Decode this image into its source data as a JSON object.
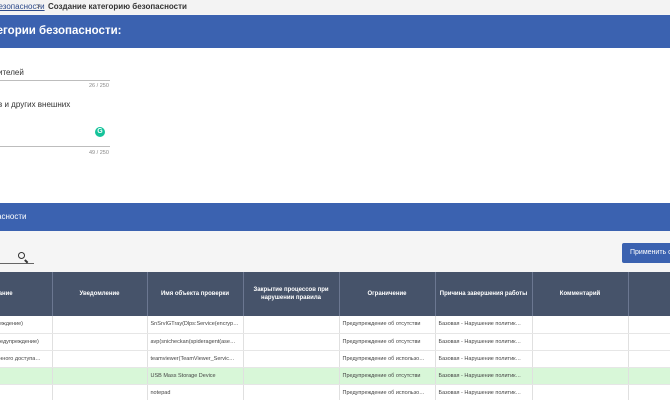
{
  "breadcrumb": {
    "parent": "безопасности",
    "separator": ">",
    "current": "Создание категорию безопасности"
  },
  "form": {
    "header": "тегории безопасности:",
    "field1": {
      "value": "ителей",
      "counter": "26 / 250"
    },
    "field2": {
      "value": "в и других внешних",
      "counter": "49 / 250"
    }
  },
  "section2": {
    "header": "асности"
  },
  "search": {
    "value": ""
  },
  "apply_button": "Применить с",
  "table": {
    "headers": [
      "вание",
      "Уведомление",
      "Имя объекта проверки",
      "Закрытие процессов при нарушении правила",
      "Ограничение",
      "Причина завершения работы",
      "Комментарий",
      ""
    ],
    "rows": [
      {
        "highlight": false,
        "cells": [
          "преждение)",
          "",
          "SnSrvIGTray(Dlps:Service(encrypt…",
          "",
          "Предупреждение об отсутстви",
          "Базовая - Нарушение политик…",
          "",
          ""
        ]
      },
      {
        "highlight": false,
        "cells": [
          "Предупреждение)",
          "",
          "avp(snicheckan(spideragent(ase…",
          "",
          "Предупреждение об отсутстви",
          "Базовая - Нарушение политик…",
          "",
          ""
        ]
      },
      {
        "highlight": false,
        "cells": [
          "ленного доступа…",
          "",
          "teamviewer(TeamViewer_Servic…",
          "",
          "Предупреждение об использо…",
          "Базовая - Нарушение политик…",
          "",
          ""
        ]
      },
      {
        "highlight": true,
        "cells": [
          "",
          "",
          "USB Mass Storage Device",
          "",
          "Предупреждение об отсутстви",
          "Базовая - Нарушение политик…",
          "",
          ""
        ]
      },
      {
        "highlight": false,
        "cells": [
          "",
          "",
          "notepad",
          "",
          "Предупреждение об использо…",
          "Базовая - Нарушение политик…",
          "",
          ""
        ]
      }
    ]
  }
}
